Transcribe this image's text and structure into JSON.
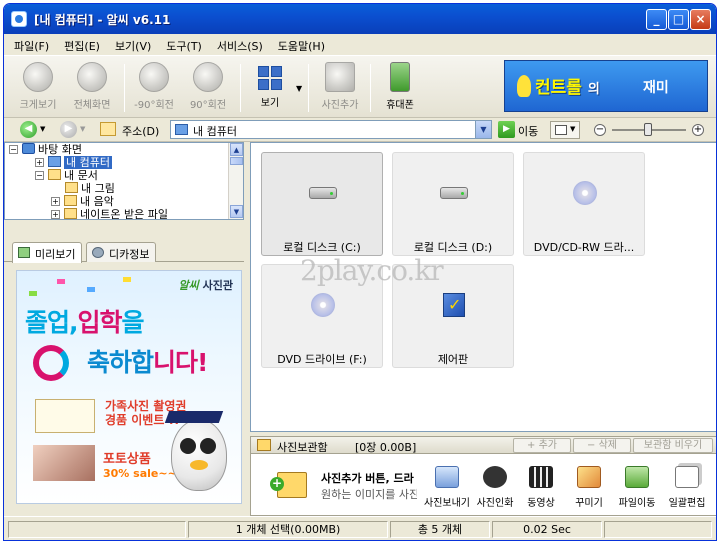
{
  "window": {
    "title": "[내 컴퓨터] - 알씨 v6.11",
    "controls": {
      "minimize": "_",
      "maximize": "□",
      "close": "×"
    }
  },
  "menu": [
    "파일(F)",
    "편집(E)",
    "보기(V)",
    "도구(T)",
    "서비스(S)",
    "도움말(H)"
  ],
  "toolbar": {
    "buttons": [
      {
        "label": "크게보기",
        "icon": "webcam-icon",
        "enabled": false
      },
      {
        "label": "전체화면",
        "icon": "camera-icon",
        "enabled": false
      },
      {
        "label": "-90°회전",
        "icon": "rotate-left-icon",
        "enabled": false
      },
      {
        "label": "90°회전",
        "icon": "rotate-right-icon",
        "enabled": false
      },
      {
        "label": "보기",
        "icon": "view-grid-icon",
        "enabled": true
      },
      {
        "label": "사진추가",
        "icon": "photo-add-icon",
        "enabled": false
      },
      {
        "label": "휴대폰",
        "icon": "phone-icon",
        "enabled": true
      }
    ],
    "banner": {
      "text1": "컨트롤",
      "text2": "의",
      "text3": "재미"
    }
  },
  "addressbar": {
    "label": "주소(D)",
    "value": "내 컴퓨터",
    "go_label": "이동"
  },
  "tree": [
    {
      "label": "바탕 화면",
      "expander": "",
      "icon": "desktop-icon"
    },
    {
      "label": "내 컴퓨터",
      "expander": "+",
      "icon": "computer-icon",
      "selected": true
    },
    {
      "label": "내 문서",
      "expander": "−",
      "icon": "folder-icon"
    },
    {
      "label": "내 그림",
      "expander": "",
      "icon": "folder-icon"
    },
    {
      "label": "내 음악",
      "expander": "+",
      "icon": "folder-icon"
    },
    {
      "label": "네이트온 받은 파일",
      "expander": "+",
      "icon": "folder-icon"
    }
  ],
  "panel_tabs": [
    {
      "label": "미리보기",
      "active": true
    },
    {
      "label": "디카정보",
      "active": false
    }
  ],
  "preview_ad": {
    "brand_em": "알씨",
    "brand": "사진관",
    "line1a": "졸업",
    "line1b": ",",
    "line1c": "입학",
    "line1d": "을",
    "line2a": "축하합",
    "line2b": "니다!",
    "event1": "가족사진 촬영권",
    "event2": "경품 이벤트 !!",
    "sale1": "포토상품",
    "sale2": "30% sale~~"
  },
  "items": [
    {
      "label": "로컬 디스크 (C:)",
      "icon": "hard-drive-icon",
      "selected": true
    },
    {
      "label": "로컬 디스크 (D:)",
      "icon": "hard-drive-icon",
      "selected": false
    },
    {
      "label": "DVD/CD-RW 드라...",
      "icon": "cd-drive-icon",
      "selected": false
    },
    {
      "label": "DVD 드라이브 (F:)",
      "icon": "dvd-drive-icon",
      "selected": false
    },
    {
      "label": "제어판",
      "icon": "control-panel-icon",
      "selected": false
    }
  ],
  "watermark": "2play.co.kr",
  "photo_box": {
    "title": "사진보관함",
    "count": "[0장 0.00B]",
    "buttons": [
      "+ 추가",
      "− 삭제",
      "보관함 비우기"
    ],
    "hint1": "사진추가 버튼, 드라",
    "hint2": "원하는 이미지를 사진",
    "actions": [
      "사진보내기",
      "사진인화",
      "동영상",
      "꾸미기",
      "파일이동",
      "일괄편집"
    ]
  },
  "status": {
    "selection": "1 개체 선택(0.00MB)",
    "total": "총 5 개체",
    "time": "0.02 Sec"
  }
}
